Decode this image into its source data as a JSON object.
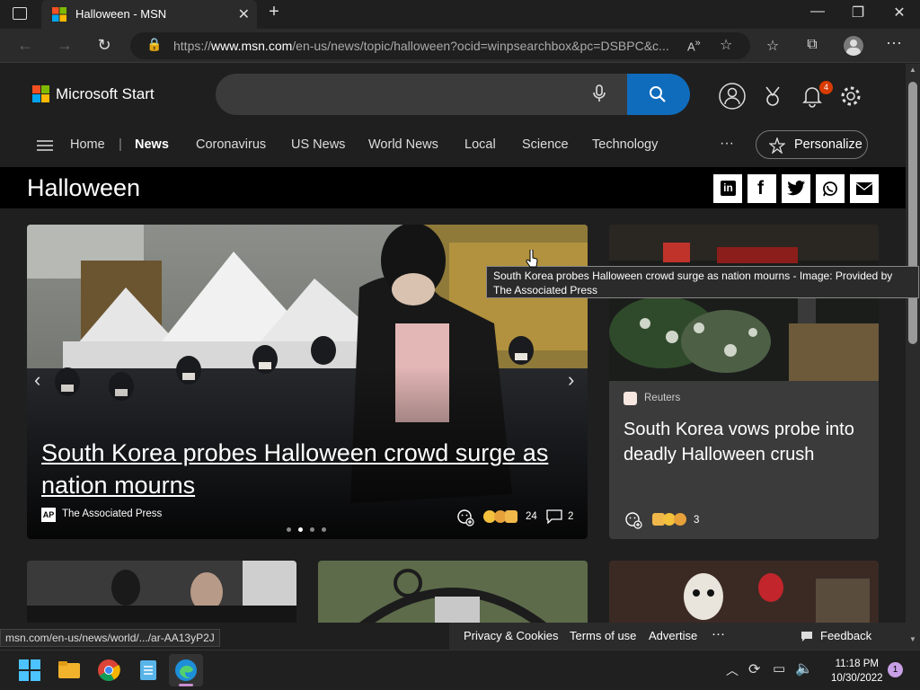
{
  "browser": {
    "tab_title": "Halloween - MSN",
    "url_prefix": "https://",
    "url_domain": "www.msn.com",
    "url_rest": "/en-us/news/topic/halloween?ocid=winpsearchbox&pc=DSBPC&c..."
  },
  "header": {
    "brand": "Microsoft Start",
    "notification_count": "4",
    "colors": {
      "accent": "#0f6cbd",
      "badge": "#d83b01"
    }
  },
  "nav": {
    "items": [
      "Home",
      "News",
      "Coronavirus",
      "US News",
      "World News",
      "Local",
      "Science",
      "Technology"
    ],
    "more": "···",
    "personalize": "Personalize"
  },
  "topic": {
    "title": "Halloween"
  },
  "hero": {
    "headline": "South Korea probes Halloween crowd surge as nation mourns",
    "source_badge": "AP",
    "source": "The Associated Press",
    "reaction_count": "24",
    "comment_count": "2",
    "slide_count": 4,
    "active_slide": 2
  },
  "side_card": {
    "source": "Reuters",
    "headline": "South Korea vows probe into deadly Halloween crush",
    "reaction_count": "3"
  },
  "tooltip": "South Korea probes Halloween crowd surge as nation mourns - Image: Provided by The Associated Press",
  "status_url": "msn.com/en-us/news/world/.../ar-AA13yP2J",
  "footer": {
    "privacy": "Privacy & Cookies",
    "terms": "Terms of use",
    "advertise": "Advertise",
    "more": "···",
    "feedback": "Feedback"
  },
  "taskbar": {
    "time": "11:18 PM",
    "date": "10/30/2022",
    "notification_count": "1"
  }
}
